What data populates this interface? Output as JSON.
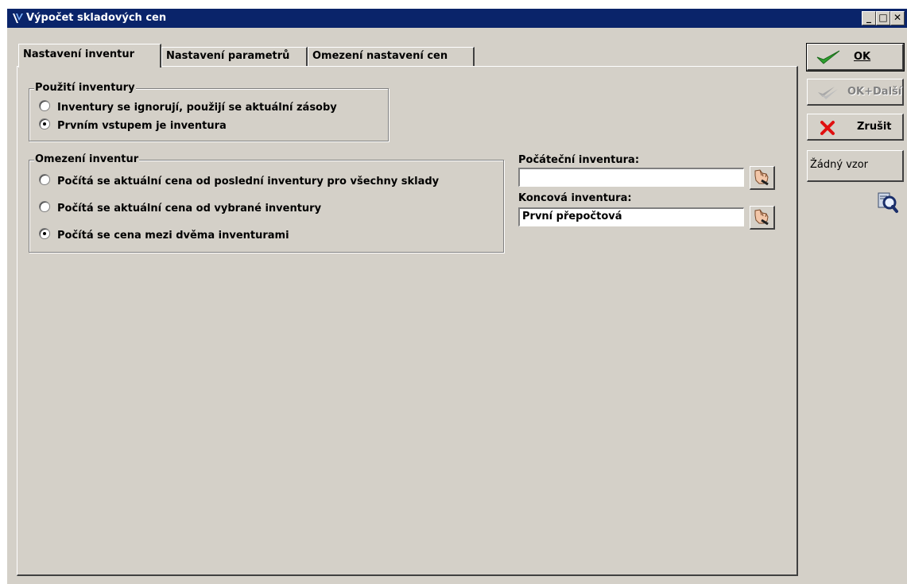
{
  "window": {
    "title": "Výpočet skladových cen",
    "minimize_glyph": "_",
    "maximize_glyph": "□",
    "close_glyph": "✕"
  },
  "tabs": [
    {
      "label": "Nastavení inventur",
      "active": true
    },
    {
      "label": "Nastavení parametrů",
      "active": false
    },
    {
      "label": "Omezení nastavení cen",
      "active": false
    }
  ],
  "usage_group": {
    "legend": "Použití inventury",
    "options": [
      {
        "label": "Inventury se ignorují, použijí se aktuální zásoby",
        "checked": false
      },
      {
        "label": "Prvním vstupem je inventura",
        "checked": true
      }
    ]
  },
  "limit_group": {
    "legend": "Omezení inventur",
    "options": [
      {
        "label": "Počítá se aktuální cena od poslední inventury pro všechny sklady",
        "checked": false
      },
      {
        "label": "Počítá se aktuální cena od vybrané inventury",
        "checked": false
      },
      {
        "label": "Počítá se cena mezi dvěma inventurami",
        "checked": true
      }
    ]
  },
  "fields": {
    "start_label": "Počáteční inventura:",
    "start_value": "",
    "end_label": "Koncová inventura:",
    "end_value": "První přepočtová"
  },
  "actions": {
    "ok_label": "OK",
    "ok_next_label": "OK+Další",
    "cancel_label": "Zrušit",
    "template_label": "Žádný vzor"
  },
  "colors": {
    "titlebar": "#0a246a",
    "face": "#d4d0c8",
    "ok_check": "#2ea02e",
    "cancel_x": "#e01010"
  },
  "icons": {
    "window": "app-logo-icon",
    "ok": "check-icon",
    "ok_next": "double-check-icon",
    "cancel": "red-x-icon",
    "picker": "pointing-hand-icon",
    "help": "magnifier-help-icon"
  }
}
